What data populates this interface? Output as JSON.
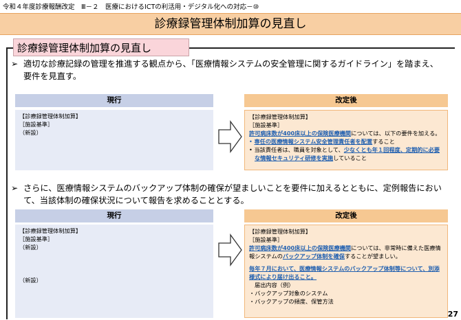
{
  "header": {
    "breadcrumb": "令和４年度診療報酬改定　Ⅲ－２　医療におけるICTの利活用・デジタル化への対応－⑩",
    "title": "診療録管理体制加算の見直し"
  },
  "section": {
    "tag": "診療録管理体制加算の見直し"
  },
  "bullets": [
    {
      "marker": "➢",
      "text": "適切な診療記録の管理を推進する観点から、「医療情報システムの安全管理に関するガイドライン」を踏まえ、要件を見直す。"
    },
    {
      "marker": "➢",
      "text": "さらに、医療情報システムのバックアップ体制の確保が望ましいことを要件に加えるとともに、定例報告において、当該体制の確保状況について報告を求めることとする。"
    }
  ],
  "comparison1": {
    "current_header": "現行",
    "new_header": "改定後",
    "current": {
      "line1": "【診療録管理体制加算】",
      "line2": "［施設基準］",
      "line3": "（新設）"
    },
    "new": {
      "line1": "【診療録管理体制加算】",
      "line2": "［施設基準］",
      "hl1": "許可病床数が400床以上の保険医療機関",
      "t1": "については、以下の要件を加える。",
      "b1_mark": "•",
      "b1_hl": "専任の医療情報システム安全管理責任者を配置",
      "b1_t": "すること",
      "b2_mark": "•",
      "b2_t1": "当該責任者は、職員を対象として、",
      "b2_hl": "少なくとも年１回程度、定期的に必要な情報セキュリティ研修を実施",
      "b2_t2": "していること"
    }
  },
  "comparison2": {
    "current_header": "現行",
    "new_header": "改定後",
    "current": {
      "line1": "【診療録管理体制加算】",
      "line2": "［施設基準］",
      "line3": "（新設）",
      "line4": "（新設）"
    },
    "new": {
      "line1": "【診療録管理体制加算】",
      "line2": "［施設基準］",
      "hl1": "許可病床数が400床以上の保険医療機関",
      "t1": "については、非常時に備えた医療情報システムの",
      "hl2": "バックアップ体制を確保",
      "t2": "することが望ましい。",
      "hl3": "毎年７月において、医療情報システムのバックアップ体制等について、別添様式により届け出ること。",
      "l5": "届出内容（例）",
      "l6": "・バックアップ対象のシステム",
      "l7": "・バックアップの頻度、保管方法"
    }
  },
  "page_number": "27"
}
